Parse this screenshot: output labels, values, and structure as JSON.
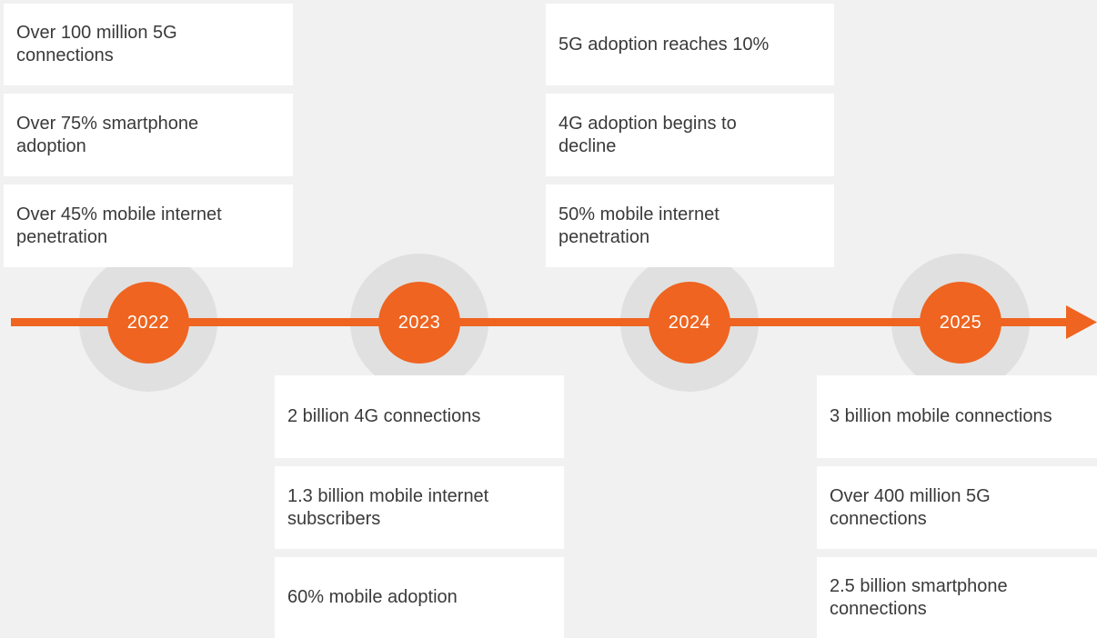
{
  "colors": {
    "accent": "#ee6420",
    "halo": "#e0e0e0",
    "background": "#f1f1f1",
    "card": "#ffffff",
    "text": "#3a3a3a"
  },
  "milestones": [
    {
      "year": "2022",
      "facts": [
        "Over 100 million 5G connections",
        "Over 75% smartphone adoption",
        "Over 45% mobile internet penetration"
      ]
    },
    {
      "year": "2023",
      "facts": [
        "2 billion 4G connections",
        "1.3 billion mobile internet subscribers",
        "60% mobile adoption"
      ]
    },
    {
      "year": "2024",
      "facts": [
        "5G adoption reaches 10%",
        "4G adoption begins to decline",
        "50% mobile internet penetration"
      ]
    },
    {
      "year": "2025",
      "facts": [
        "3 billion mobile connections",
        "Over 400 million 5G connections",
        "2.5 billion smartphone connections"
      ]
    }
  ]
}
